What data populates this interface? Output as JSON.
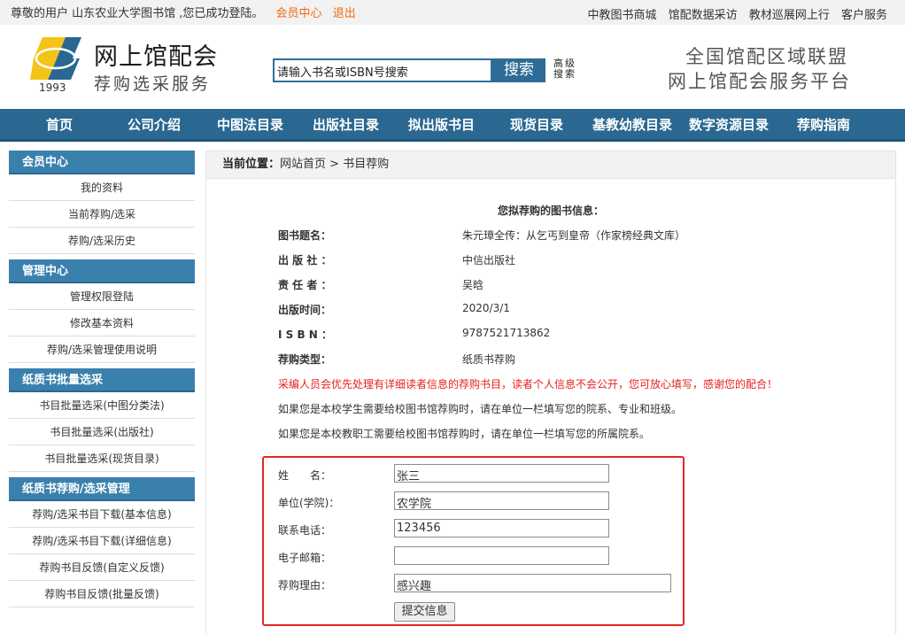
{
  "topbar": {
    "greeting": "尊敬的用户 山东农业大学图书馆 ,您已成功登陆。",
    "member_center": "会员中心",
    "logout": "退出",
    "links": [
      "中教图书商城",
      "馆配数据采访",
      "教材巡展网上行",
      "客户服务"
    ]
  },
  "header": {
    "title": "网上馆配会",
    "subtitle": "荐购选采服务",
    "year": "1993",
    "search_placeholder": "请输入书名或ISBN号搜索",
    "search_button": "搜索",
    "advanced_search": "高级搜索",
    "slogan_line1": "全国馆配区域联盟",
    "slogan_line2": "网上馆配会服务平台"
  },
  "nav": [
    "首页",
    "公司介绍",
    "中图法目录",
    "出版社目录",
    "拟出版书目",
    "现货目录",
    "基教幼教目录",
    "数字资源目录",
    "荐购指南"
  ],
  "sidebar": {
    "sections": [
      {
        "title": "会员中心",
        "items": [
          "我的资料",
          "当前荐购/选采",
          "荐购/选采历史"
        ]
      },
      {
        "title": "管理中心",
        "items": [
          "管理权限登陆",
          "修改基本资料",
          "荐购/选采管理使用说明"
        ]
      },
      {
        "title": "纸质书批量选采",
        "items": [
          "书目批量选采(中图分类法)",
          "书目批量选采(出版社)",
          "书目批量选采(现货目录)"
        ]
      },
      {
        "title": "纸质书荐购/选采管理",
        "items": [
          "荐购/选采书目下载(基本信息)",
          "荐购/选采书目下载(详细信息)",
          "荐购书目反馈(自定义反馈)",
          "荐购书目反馈(批量反馈)"
        ]
      }
    ]
  },
  "breadcrumb": {
    "label": "当前位置：",
    "home": "网站首页",
    "sep": ">",
    "current": "书目荐购"
  },
  "book_info": {
    "heading": "您拟荐购的图书信息：",
    "rows": [
      {
        "label": "图书题名：",
        "value": "朱元璋全传：从乞丐到皇帝（作家榜经典文库）"
      },
      {
        "label": "出 版 社 ：",
        "value": "中信出版社"
      },
      {
        "label": "责 任 者 ：",
        "value": "吴晗"
      },
      {
        "label": "出版时间：",
        "value": "2020/3/1"
      },
      {
        "label": "I S B N ：",
        "value": "9787521713862"
      },
      {
        "label": "荐购类型：",
        "value": "纸质书荐购"
      }
    ]
  },
  "notes": {
    "red": "采编人员会优先处理有详细读者信息的荐购书目，读者个人信息不会公开，您可放心填写，感谢您的配合！",
    "student": "如果您是本校学生需要给校图书馆荐购时，请在单位一栏填写您的院系、专业和班级。",
    "staff": "如果您是本校教职工需要给校图书馆荐购时，请在单位一栏填写您的所属院系。"
  },
  "form": {
    "name_label": "姓　　名：",
    "name_value": "张三",
    "unit_label": "单位(学院)：",
    "unit_value": "农学院",
    "phone_label": "联系电话：",
    "phone_value": "123456",
    "email_label": "电子邮箱：",
    "email_value": "",
    "reason_label": "荐购理由：",
    "reason_value": "感兴趣",
    "submit": "提交信息"
  },
  "colors": {
    "nav_bg": "#2a6891",
    "accent_orange": "#f26a10",
    "highlight_red": "#e52727",
    "sidebar_head": "#3a80ad"
  }
}
